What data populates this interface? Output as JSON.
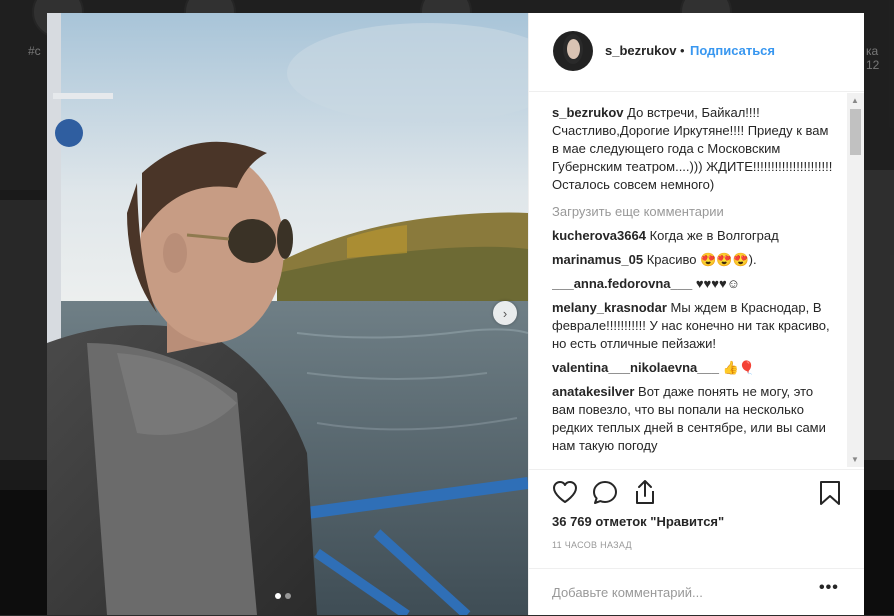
{
  "background": {
    "tags": [
      "#c",
      "ка 12"
    ]
  },
  "post": {
    "username": "s_bezrukov",
    "bullet": "•",
    "follow_label": "Подписаться",
    "caption_user": "s_bezrukov",
    "caption_text": "До встречи, Байкал!!!! Счастливо,Дорогие Иркутяне!!!! Приеду к вам в мае следующего года с Московским Губернским театром....))) ЖДИТЕ!!!!!!!!!!!!!!!!!!!!!! Осталось совсем немного)",
    "load_more": "Загрузить еще комментарии",
    "comments": [
      {
        "user": "kucherova3664",
        "text": "Когда же в Волгоград"
      },
      {
        "user": "marinamus_05",
        "text": "Красиво 😍😍😍)."
      },
      {
        "user": "___anna.fedorovna___",
        "text": "♥♥♥♥☺"
      },
      {
        "user": "melany_krasnodar",
        "text": "Мы ждем в Краснодар, В феврале!!!!!!!!!!! У нас конечно ни так красиво, но есть отличные пейзажи!"
      },
      {
        "user": "valentina___nikolaevna___",
        "text": "👍🎈"
      },
      {
        "user": "anatakesilver",
        "text": "Вот даже понять не могу, это вам повезло, что вы попали на несколько редких теплых дней в сентябре, или вы сами нам такую погоду"
      }
    ],
    "likes": "36 769 отметок \"Нравится\"",
    "time": "11 ЧАСОВ НАЗАД",
    "add_comment_placeholder": "Добавьте комментарий...",
    "more_label": "•••",
    "next_icon": "›"
  },
  "colors": {
    "link": "#3897f0",
    "text": "#262626",
    "muted": "#999999"
  }
}
